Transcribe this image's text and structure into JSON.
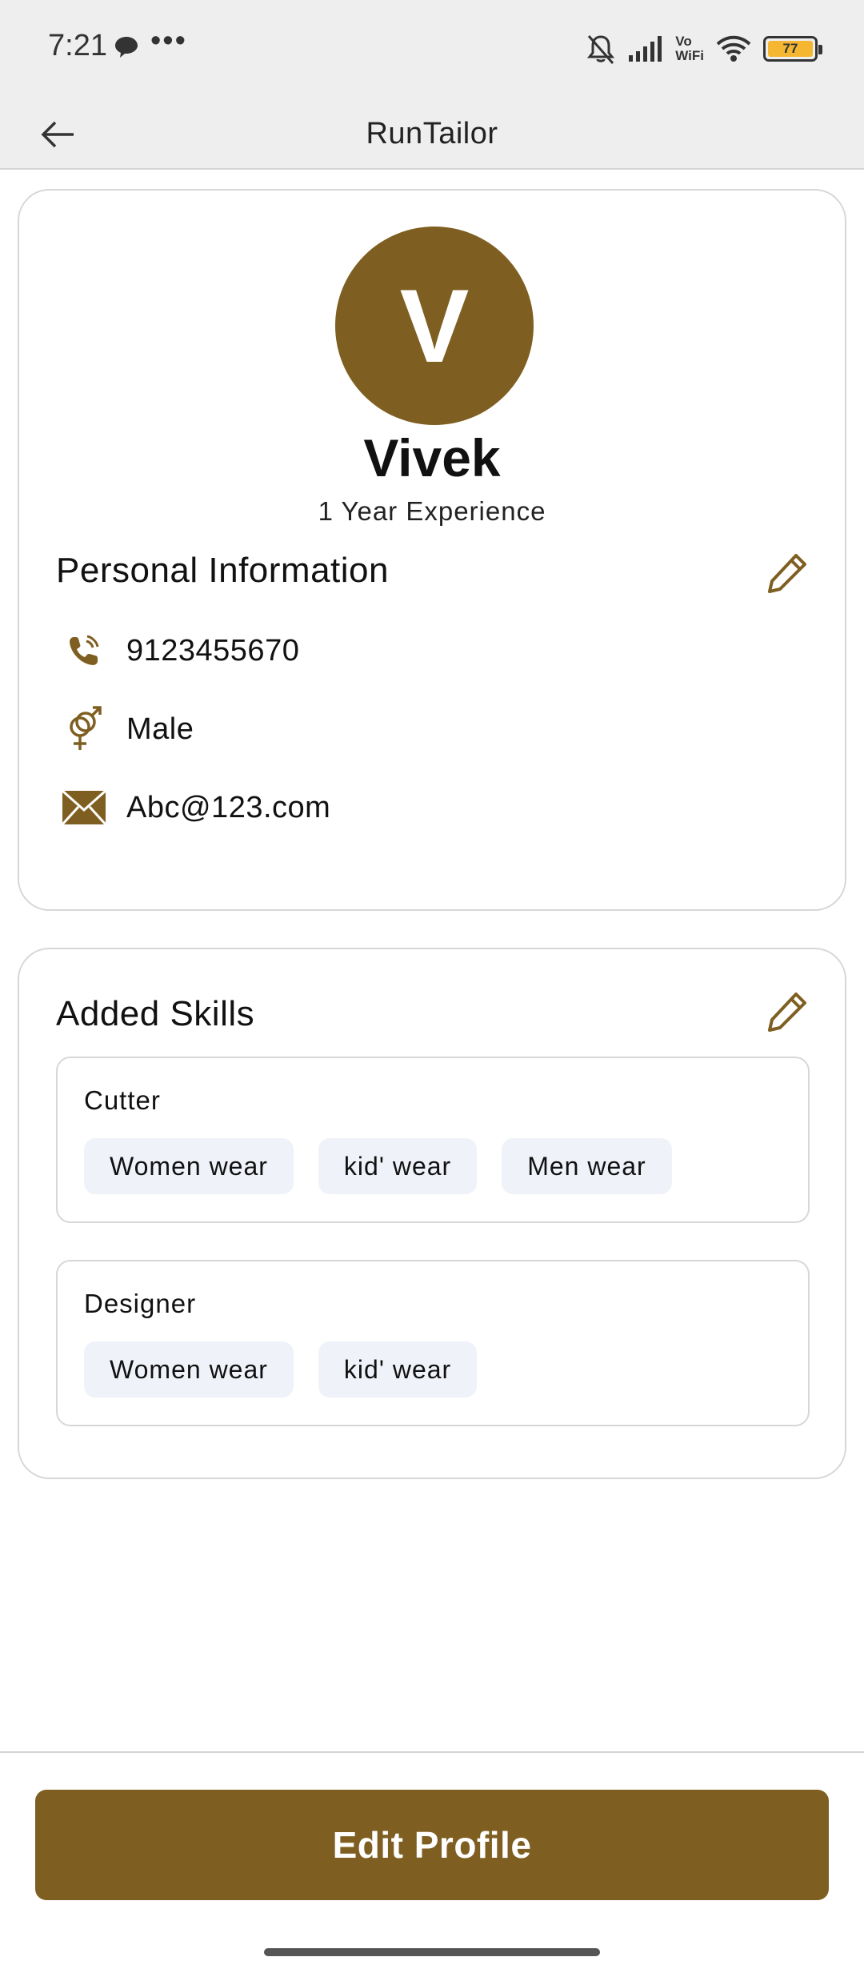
{
  "status_bar": {
    "time": "7:21",
    "dots": "•••",
    "vowifi_top": "Vo",
    "vowifi_bottom": "WiFi",
    "battery_level": "77"
  },
  "app_bar": {
    "title": "RunTailor"
  },
  "profile": {
    "avatar_initial": "V",
    "name": "Vivek",
    "experience": "1 Year Experience",
    "section_title": "Personal Information",
    "phone": "9123455670",
    "gender": "Male",
    "email": "Abc@123.com"
  },
  "skills": {
    "section_title": "Added Skills",
    "groups": [
      {
        "name": "Cutter",
        "items": [
          "Women wear",
          "kid' wear",
          "Men wear"
        ]
      },
      {
        "name": "Designer",
        "items": [
          "Women wear",
          "kid' wear"
        ]
      }
    ]
  },
  "actions": {
    "edit_profile_label": "Edit Profile"
  },
  "colors": {
    "brand": "#7f5f21",
    "chip_bg": "#eff2f8",
    "status_bar_bg": "#eeeeee",
    "battery": "#f5b731"
  },
  "icons": {
    "back": "arrow-left-icon",
    "edit": "pencil-icon",
    "phone": "phone-icon",
    "gender": "gender-icon",
    "email": "envelope-icon"
  }
}
